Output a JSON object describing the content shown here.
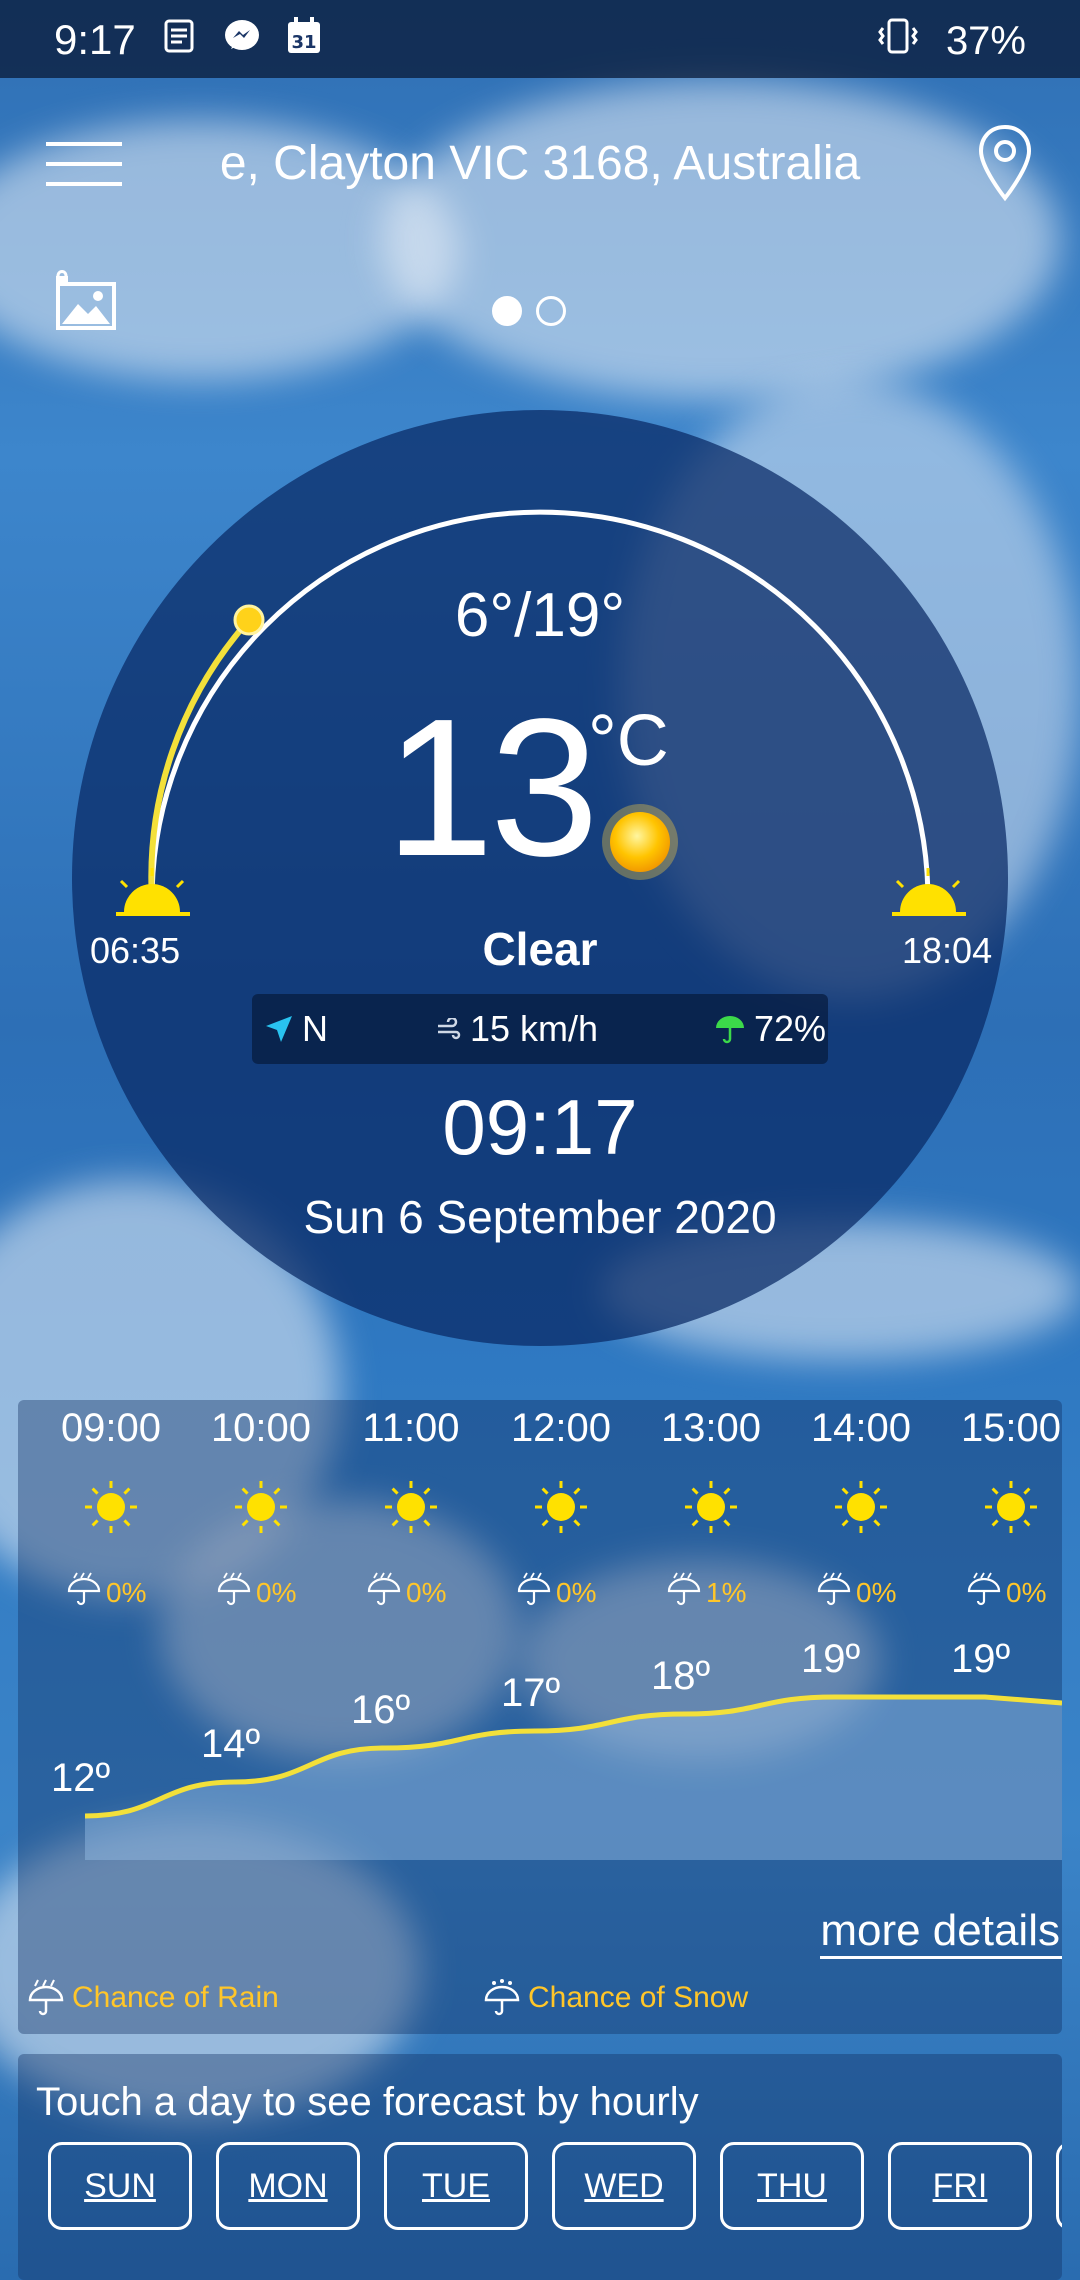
{
  "status_bar": {
    "time": "9:17",
    "battery": "37%"
  },
  "header": {
    "location": "e, Clayton VIC 3168, Australia"
  },
  "current": {
    "temp_range": "6°/19°",
    "temp": "13",
    "unit": "°C",
    "sunrise": "06:35",
    "sunset": "18:04",
    "condition": "Clear",
    "wind_dir": "N",
    "wind_speed": "15 km/h",
    "humidity": "72%",
    "clock": "09:17",
    "date": "Sun 6 September 2020"
  },
  "hourly": [
    {
      "time": "09:00",
      "rain": "0%",
      "temp": "12º"
    },
    {
      "time": "10:00",
      "rain": "0%",
      "temp": "14º"
    },
    {
      "time": "11:00",
      "rain": "0%",
      "temp": "16º"
    },
    {
      "time": "12:00",
      "rain": "0%",
      "temp": "17º"
    },
    {
      "time": "13:00",
      "rain": "1%",
      "temp": "18º"
    },
    {
      "time": "14:00",
      "rain": "0%",
      "temp": "19º"
    },
    {
      "time": "15:00",
      "rain": "0%",
      "temp": "19º"
    }
  ],
  "hourly_panel": {
    "more_details": "more details",
    "legend_rain": "Chance of Rain",
    "legend_snow": "Chance of Snow"
  },
  "daily": {
    "hint": "Touch a day to see forecast by hourly",
    "days": [
      "SUN",
      "MON",
      "TUE",
      "WED",
      "THU",
      "FRI"
    ]
  },
  "colors": {
    "accent_yellow": "#ffc629",
    "sun_yellow": "#ffe100",
    "curve_yellow": "#f3e03a"
  }
}
